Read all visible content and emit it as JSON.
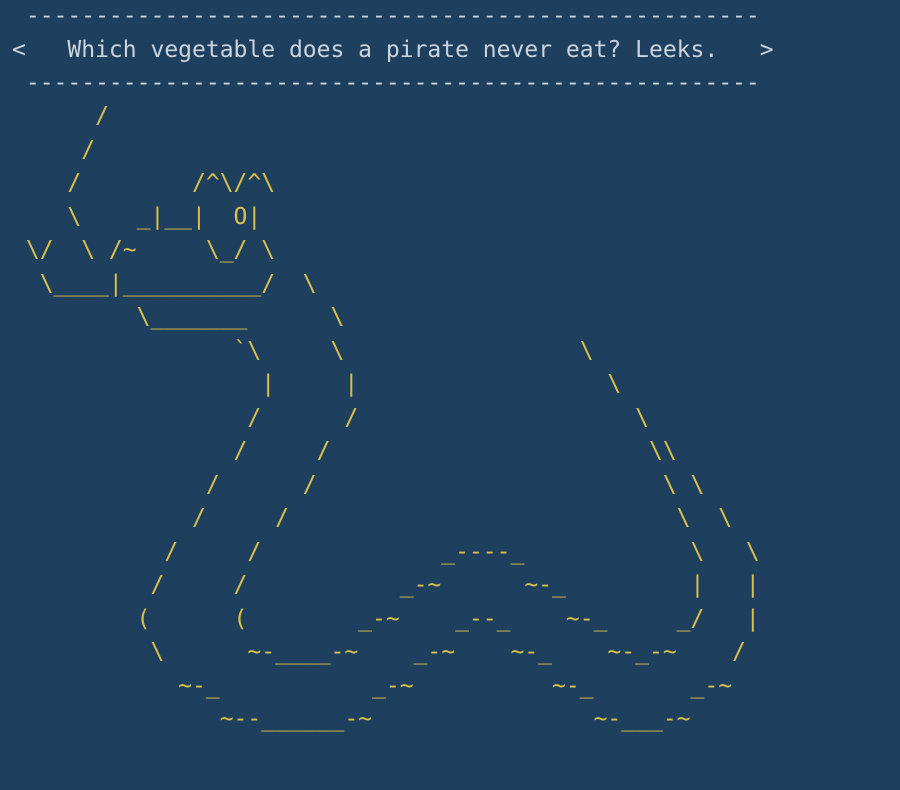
{
  "terminal": {
    "bubble": {
      "top_border": " -----------------------------------------------------",
      "message_line": "<   Which vegetable does a pirate never eat? Leeks.   >",
      "bottom_border": " -----------------------------------------------------"
    },
    "ascii_art": [
      "      /",
      "     /",
      "    /        /^\\/^\\",
      "    \\    _|__|  O|",
      " \\/  \\ /~     \\_/ \\",
      "  \\____|__________/  \\",
      "         \\_______      \\",
      "                `\\     \\                 \\",
      "                  |     |                  \\",
      "                 /      /                    \\",
      "                /     /                       \\\\",
      "              /      /                         \\ \\",
      "             /     /                            \\  \\",
      "           /     /             _----_            \\   \\",
      "          /     /           _-~      ~-_         |   |",
      "         (      (        _-~    _--_    ~-_     _/   |",
      "          \\      ~-____-~    _-~    ~-_    ~-_-~    /",
      "            ~-_           _-~          ~-_       _-~",
      "               ~--______-~                ~-___-~"
    ],
    "colors": {
      "background": "#1f3f5f",
      "bubble_text": "#c9d4de",
      "art_text": "#d9c24a"
    }
  }
}
